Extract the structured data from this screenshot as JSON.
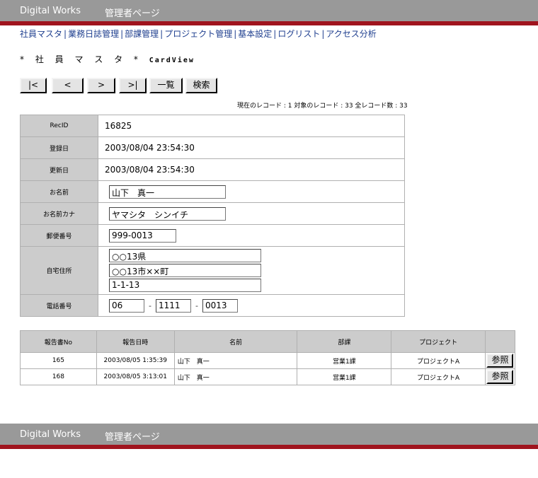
{
  "header": {
    "brand": "Digital Works",
    "subtitle": "管理者ページ"
  },
  "nav": {
    "items": [
      "社員マスタ",
      "業務日誌管理",
      "部課管理",
      "プロジェクト管理",
      "基本設定",
      "ログリスト",
      "アクセス分析"
    ],
    "separator": "|"
  },
  "page": {
    "title_jp": "* 社 員 マ ス タ *",
    "title_en": "CardView"
  },
  "toolbar": {
    "first": "|<",
    "prev": "<",
    "next": ">",
    "last": ">|",
    "list": "一覧",
    "search": "検索"
  },
  "status": "現在のレコード : 1 対象のレコード : 33 全レコード数 : 33",
  "record": {
    "recid_label": "RecID",
    "recid": "16825",
    "created_label": "登録日",
    "created": "2003/08/04 23:54:30",
    "updated_label": "更新日",
    "updated": "2003/08/04 23:54:30",
    "name_label": "お名前",
    "name": "山下　真一",
    "kana_label": "お名前カナ",
    "kana": "ヤマシタ　シンイチ",
    "zip_label": "郵便番号",
    "zip": "999-0013",
    "address_label": "自宅住所",
    "address1": "○○13県",
    "address2": "○○13市××町",
    "address3": "1-1-13",
    "phone_label": "電話番号",
    "phone1": "06",
    "phone2": "1111",
    "phone3": "0013",
    "phone_sep": "-"
  },
  "reports": {
    "headers": [
      "報告書No",
      "報告日時",
      "名前",
      "部課",
      "プロジェクト",
      ""
    ],
    "rows": [
      {
        "no": "165",
        "datetime": "2003/08/05 1:35:39",
        "name": "山下　真一",
        "dept": "営業1課",
        "project": "プロジェクトA",
        "action": "参照"
      },
      {
        "no": "168",
        "datetime": "2003/08/05 3:13:01",
        "name": "山下　真一",
        "dept": "営業1課",
        "project": "プロジェクトA",
        "action": "参照"
      }
    ]
  },
  "footer": {
    "brand": "Digital Works",
    "subtitle": "管理者ページ"
  },
  "colors": {
    "bar": "#999999",
    "accent": "#a0141e",
    "label_bg": "#cccccc",
    "link": "#1f3f8f"
  }
}
